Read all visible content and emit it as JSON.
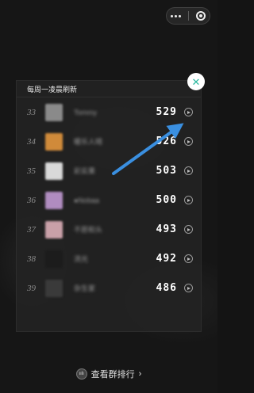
{
  "capsule": {
    "more_icon": "more-dots-icon",
    "close_icon": "target-icon"
  },
  "panel": {
    "header": "每周一凌晨刷新",
    "close_icon": "✕",
    "rows": [
      {
        "rank": "33",
        "name": "Tommy",
        "score": "529",
        "avatar_color": "#8a8a8a"
      },
      {
        "rank": "34",
        "name": "暖乐人晴",
        "score": "526",
        "avatar_color": "#d08a3a"
      },
      {
        "rank": "35",
        "name": "彩实果",
        "score": "503",
        "avatar_color": "#d9d9d9"
      },
      {
        "rank": "36",
        "name": "●Nobaa",
        "score": "500",
        "avatar_color": "#b08cc0"
      },
      {
        "rank": "37",
        "name": "不愿和头",
        "score": "493",
        "avatar_color": "#c9a0a8"
      },
      {
        "rank": "38",
        "name": "流光",
        "score": "492",
        "avatar_color": "#1c1c1c"
      },
      {
        "rank": "39",
        "name": "杂生家",
        "score": "486",
        "avatar_color": "#3a3a3a"
      }
    ]
  },
  "footer": {
    "icon_text": "ıılı",
    "label": "查看群排行",
    "chevron": "›"
  },
  "colors": {
    "accent": "#2bb9a0",
    "arrow": "#3a8fe0"
  }
}
